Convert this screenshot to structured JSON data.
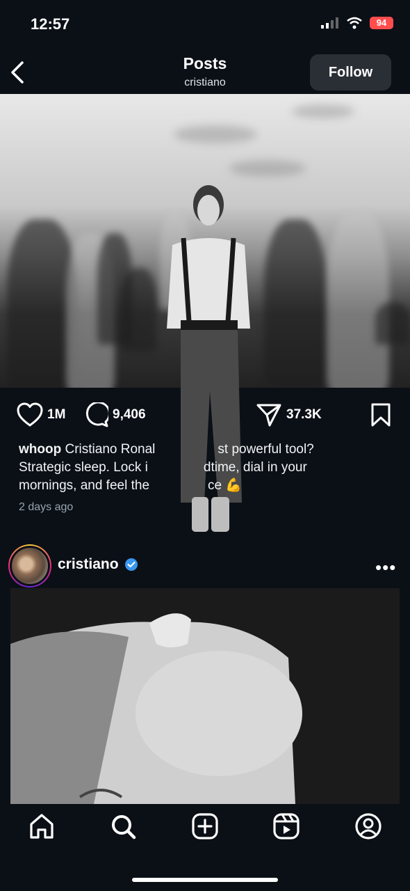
{
  "status_bar": {
    "time": "12:57",
    "battery": "94"
  },
  "header": {
    "title": "Posts",
    "subtitle": "cristiano",
    "follow_label": "Follow"
  },
  "post1": {
    "likes": "1M",
    "comments": "9,406",
    "shares": "37.3K",
    "caption_user": "whoop",
    "caption_line1": "Cristiano Ronal",
    "caption_line1b": "st powerful tool?",
    "caption_line2a": "Strategic sleep. Lock i",
    "caption_line2b": "dtime, dial in your",
    "caption_line3a": "mornings, and feel the",
    "caption_line3b": "ce",
    "caption_emoji": "💪",
    "time_ago": "2 days ago"
  },
  "post2": {
    "username": "cristiano",
    "more": "•••"
  },
  "icons": {
    "back": "chevron-left-icon",
    "heart": "heart-icon",
    "comment": "comment-icon",
    "share": "paper-plane-icon",
    "save": "bookmark-icon",
    "verified": "verified-badge-icon",
    "home": "home-icon",
    "search": "search-icon",
    "create": "plus-square-icon",
    "reels": "reels-icon",
    "profile": "profile-icon"
  },
  "colors": {
    "background": "#0b1017",
    "verified": "#3897f0",
    "battery": "#ff4d4d",
    "follow_bg": "#2a2f36"
  }
}
